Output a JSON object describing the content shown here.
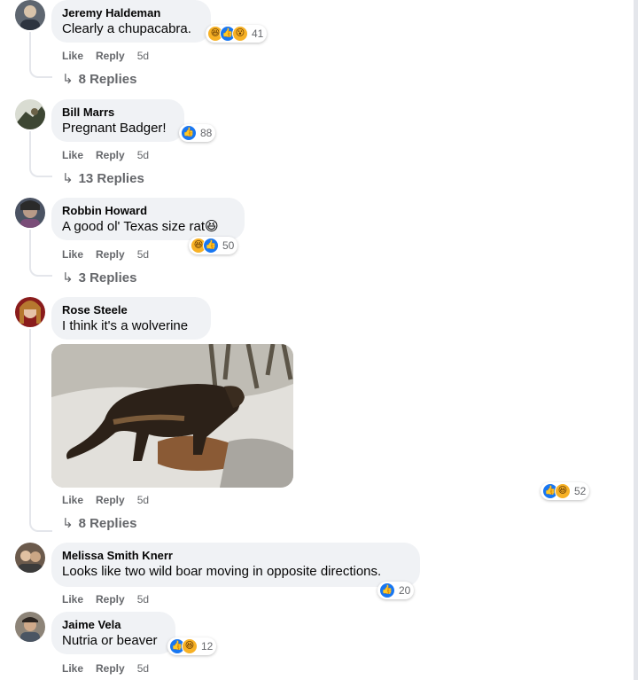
{
  "comments": [
    {
      "author": "Jeremy Haldeman",
      "text": "Clearly a chupacabra.",
      "reaction_count": "41",
      "reactions": [
        "haha",
        "like",
        "wow"
      ],
      "like_label": "Like",
      "reply_label": "Reply",
      "time": "5d",
      "replies": "8 Replies"
    },
    {
      "author": "Bill Marrs",
      "text": "Pregnant Badger!",
      "reaction_count": "88",
      "reactions": [
        "like"
      ],
      "like_label": "Like",
      "reply_label": "Reply",
      "time": "5d",
      "replies": "13 Replies"
    },
    {
      "author": "Robbin Howard",
      "text": "A good ol' Texas size rat😆",
      "reaction_count": "50",
      "reactions": [
        "haha",
        "like"
      ],
      "like_label": "Like",
      "reply_label": "Reply",
      "time": "5d",
      "replies": "3 Replies"
    },
    {
      "author": "Rose Steele",
      "text": "I think it's a wolverine",
      "reaction_count": "52",
      "reactions": [
        "like",
        "haha"
      ],
      "like_label": "Like",
      "reply_label": "Reply",
      "time": "5d",
      "replies": "8 Replies"
    },
    {
      "author": "Melissa Smith Knerr",
      "text": "Looks like two wild boar moving in opposite directions.",
      "reaction_count": "20",
      "reactions": [
        "like"
      ],
      "like_label": "Like",
      "reply_label": "Reply",
      "time": "5d"
    },
    {
      "author": "Jaime Vela",
      "text": "Nutria or beaver",
      "reaction_count": "12",
      "reactions": [
        "like",
        "haha"
      ],
      "like_label": "Like",
      "reply_label": "Reply",
      "time": "5d"
    }
  ],
  "icons": {
    "reply_arrow": "reply-arrow-icon",
    "like_reaction": "like-reaction-icon",
    "haha_reaction": "haha-reaction-icon",
    "wow_reaction": "wow-reaction-icon"
  },
  "colors": {
    "bubble": "#f0f2f5",
    "meta_text": "#65676b",
    "like_blue": "#1877f2",
    "emoji_yellow": "#f7b125"
  }
}
